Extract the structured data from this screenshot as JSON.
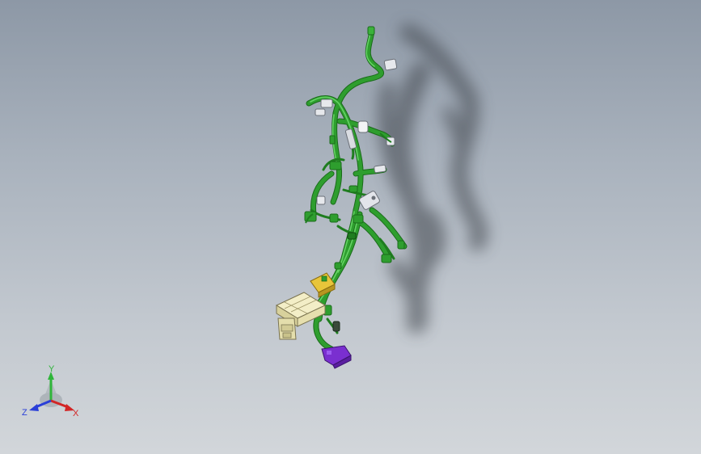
{
  "viewport": {
    "background_top": "#8d98a6",
    "background_bottom": "#d2d6da"
  },
  "model": {
    "wire_color": "#2e9e2e",
    "wire_highlight": "#5fd35f",
    "connector_white": "#e6e8ec",
    "fuse_box_color": "#ece6b6",
    "connector_yellow": "#e8c53a",
    "connector_purple": "#7a2fd0"
  },
  "triad": {
    "x_label": "X",
    "y_label": "Y",
    "z_label": "Z",
    "x_color": "#d22626",
    "y_color": "#2fb53a",
    "z_color": "#2a3fd8"
  }
}
